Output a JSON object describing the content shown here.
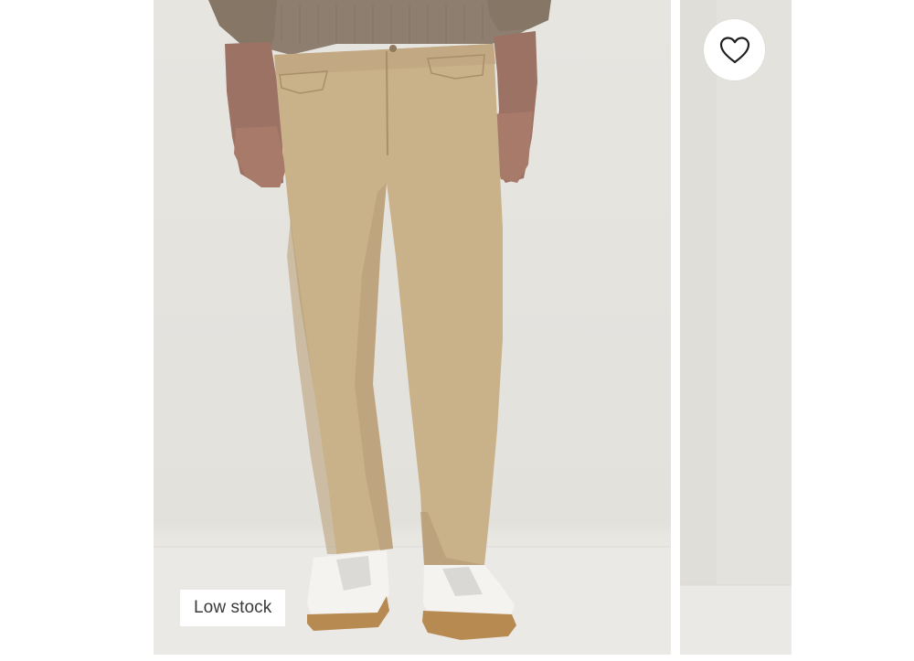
{
  "products": [
    {
      "stock_badge": "Low stock",
      "image_icon": "khaki-pants-photo"
    },
    {
      "image_icon": "product-photo-partial"
    }
  ],
  "wishlist": {
    "icon": "heart-icon"
  },
  "colors": {
    "pants": "#c9b18a",
    "sweater": "#8e7f70",
    "badge_bg": "#ffffff",
    "badge_text": "#3a3a3a",
    "heart_stroke": "#1f1f1f"
  }
}
